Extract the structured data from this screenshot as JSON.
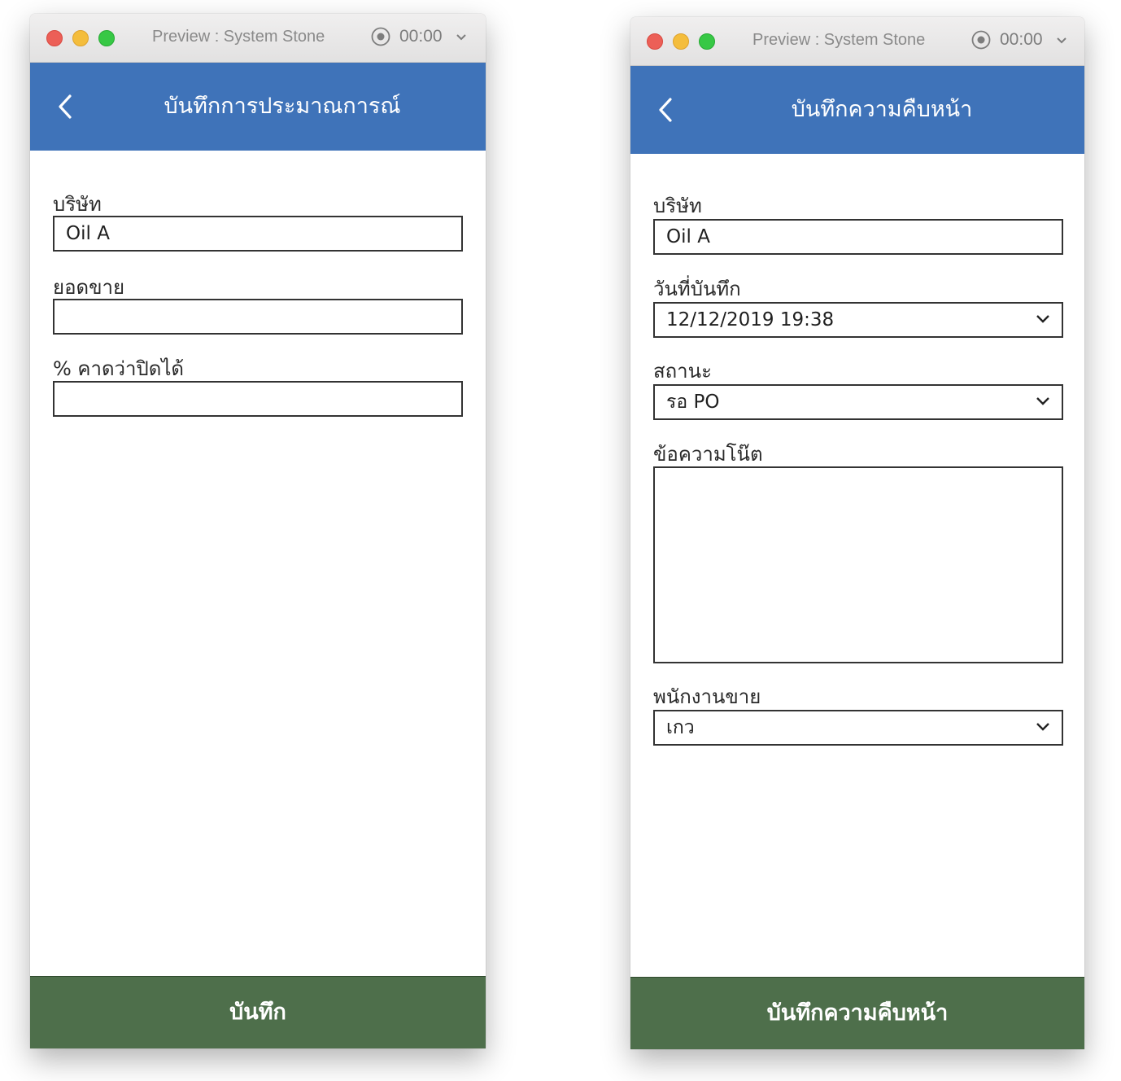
{
  "windows": {
    "left": {
      "window_title": "Preview : System Stone",
      "timer": "00:00",
      "screen_title": "บันทึกการประมาณการณ์",
      "fields": {
        "company_label": "บริษัท",
        "company_value": "Oil A",
        "sales_label": "ยอดขาย",
        "sales_value": "",
        "percent_label": "% คาดว่าปิดได้",
        "percent_value": ""
      },
      "footer_button": "บันทึก"
    },
    "right": {
      "window_title": "Preview : System Stone",
      "timer": "00:00",
      "screen_title": "บันทึกความคืบหน้า",
      "fields": {
        "company_label": "บริษัท",
        "company_value": "Oil A",
        "date_label": "วันที่บันทึก",
        "date_value": "12/12/2019 19:38",
        "status_label": "สถานะ",
        "status_value": "รอ PO",
        "note_label": "ข้อความโน๊ต",
        "note_value": "",
        "salesperson_label": "พนักงานขาย",
        "salesperson_value": "เกว"
      },
      "footer_button": "บันทึกความคืบหน้า"
    }
  },
  "colors": {
    "app_bar": "#3f73b9",
    "footer": "#4e6f4b",
    "traffic_close": "#ec5f57",
    "traffic_minimize": "#f4bd3c",
    "traffic_maximize": "#37c845"
  },
  "icons": [
    "back-chevron-icon",
    "record-icon",
    "chevron-down-icon"
  ]
}
